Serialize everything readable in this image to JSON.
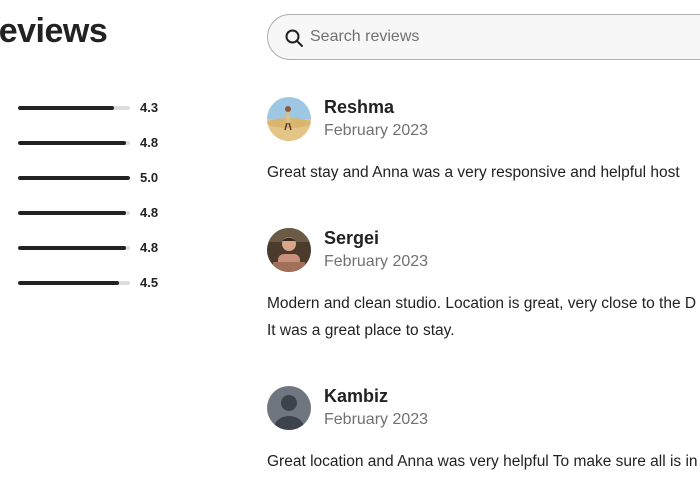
{
  "reviews_heading": "reviews",
  "category_ratings": [
    {
      "value": "4.3",
      "fill": 0.86
    },
    {
      "value": "4.8",
      "fill": 0.96
    },
    {
      "value": "5.0",
      "fill": 1.0
    },
    {
      "value": "4.8",
      "fill": 0.96
    },
    {
      "value": "4.8",
      "fill": 0.96
    },
    {
      "value": "4.5",
      "fill": 0.9
    }
  ],
  "search": {
    "placeholder": "Search reviews",
    "value": "",
    "icon": "search-icon"
  },
  "reviews": [
    {
      "name": "Reshma",
      "date": "February 2023",
      "text_lines": [
        "Great stay and Anna was a very responsive and helpful host"
      ]
    },
    {
      "name": "Sergei",
      "date": "February 2023",
      "text_lines": [
        "Modern and clean studio. Location is great, very close to the D",
        "It was a great place to stay."
      ]
    },
    {
      "name": "Kambiz",
      "date": "February 2023",
      "text_lines": [
        "Great location and Anna was very helpful To make sure all is in"
      ]
    }
  ],
  "colors": {
    "text": "#222222",
    "muted": "#717171",
    "bar_track": "#dddddd",
    "bar_fill": "#222222"
  }
}
